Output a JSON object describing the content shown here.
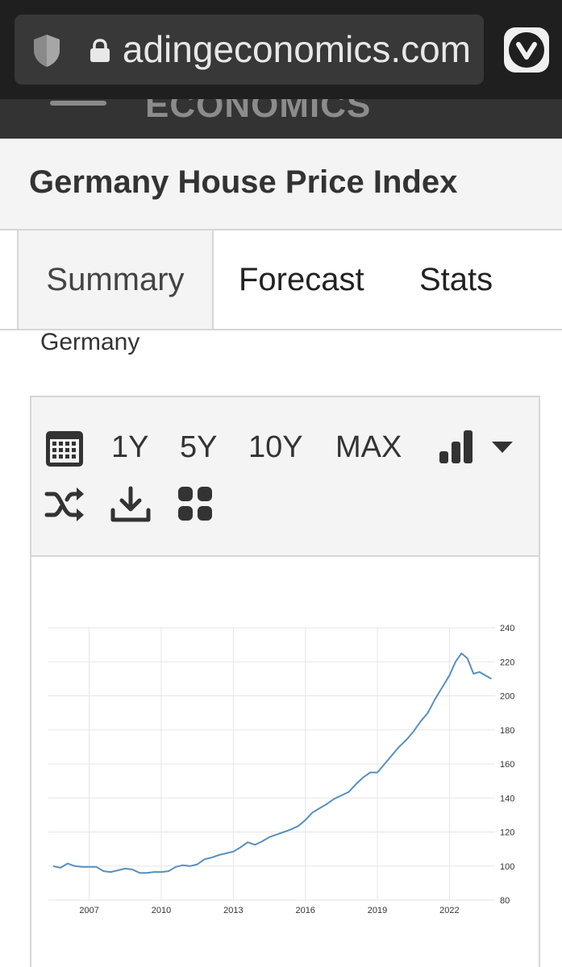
{
  "browser": {
    "url": "tradingeconomics.com"
  },
  "site": {
    "brand": "ECONOMICS"
  },
  "page": {
    "title": "Germany House Price Index",
    "country": "Germany"
  },
  "tabs": [
    {
      "label": "Summary",
      "active": true
    },
    {
      "label": "Forecast",
      "active": false
    },
    {
      "label": "Stats",
      "active": false
    }
  ],
  "toolbar": {
    "ranges": [
      "1Y",
      "5Y",
      "10Y",
      "MAX"
    ],
    "icons": [
      "calendar-icon",
      "bar-chart-icon",
      "dropdown-caret-icon",
      "shuffle-icon",
      "download-icon",
      "grid-icon"
    ]
  },
  "colors": {
    "line": "#5a8fbd",
    "grid": "#e6e6e6",
    "text": "#333333"
  },
  "chart_data": {
    "type": "line",
    "xlim": [
      2005.3,
      2023.9
    ],
    "ylim": [
      80,
      240
    ],
    "x_ticks": [
      2007,
      2010,
      2013,
      2016,
      2019,
      2022
    ],
    "y_ticks": [
      80,
      100,
      120,
      140,
      160,
      180,
      200,
      220,
      240
    ],
    "grid": true,
    "series": [
      {
        "x": [
          2005.5,
          2005.8,
          2006.1,
          2006.4,
          2006.7,
          2007.0,
          2007.3,
          2007.6,
          2007.9,
          2008.2,
          2008.5,
          2008.8,
          2009.1,
          2009.4,
          2009.7,
          2010.0,
          2010.3,
          2010.6,
          2010.9,
          2011.2,
          2011.5,
          2011.8,
          2012.1,
          2012.4,
          2012.7,
          2013.0,
          2013.3,
          2013.6,
          2013.9,
          2014.2,
          2014.5,
          2014.8,
          2015.1,
          2015.4,
          2015.7,
          2016.0,
          2016.3,
          2016.6,
          2016.9,
          2017.2,
          2017.5,
          2017.8,
          2018.1,
          2018.4,
          2018.7,
          2019.0,
          2019.3,
          2019.6,
          2019.9,
          2020.2,
          2020.5,
          2020.8,
          2021.1,
          2021.4,
          2021.7,
          2022.0,
          2022.25,
          2022.5,
          2022.75,
          2023.0,
          2023.25,
          2023.5,
          2023.75
        ],
        "y": [
          100,
          99,
          101.5,
          100,
          99.5,
          99.5,
          99.5,
          97,
          96.5,
          97.5,
          98.5,
          98,
          96,
          96,
          96.5,
          96.5,
          97,
          99.5,
          100.5,
          100,
          101,
          104,
          105,
          106.5,
          107.5,
          108.5,
          111,
          114,
          112.5,
          114.5,
          117,
          118.5,
          120,
          121.5,
          123.5,
          127,
          131.5,
          134,
          136.5,
          139.5,
          141.5,
          143.5,
          148,
          152,
          155,
          155,
          160,
          165,
          170,
          174,
          179,
          185,
          190,
          198,
          205,
          212,
          220,
          225,
          222,
          213,
          214,
          212,
          210
        ]
      }
    ]
  }
}
